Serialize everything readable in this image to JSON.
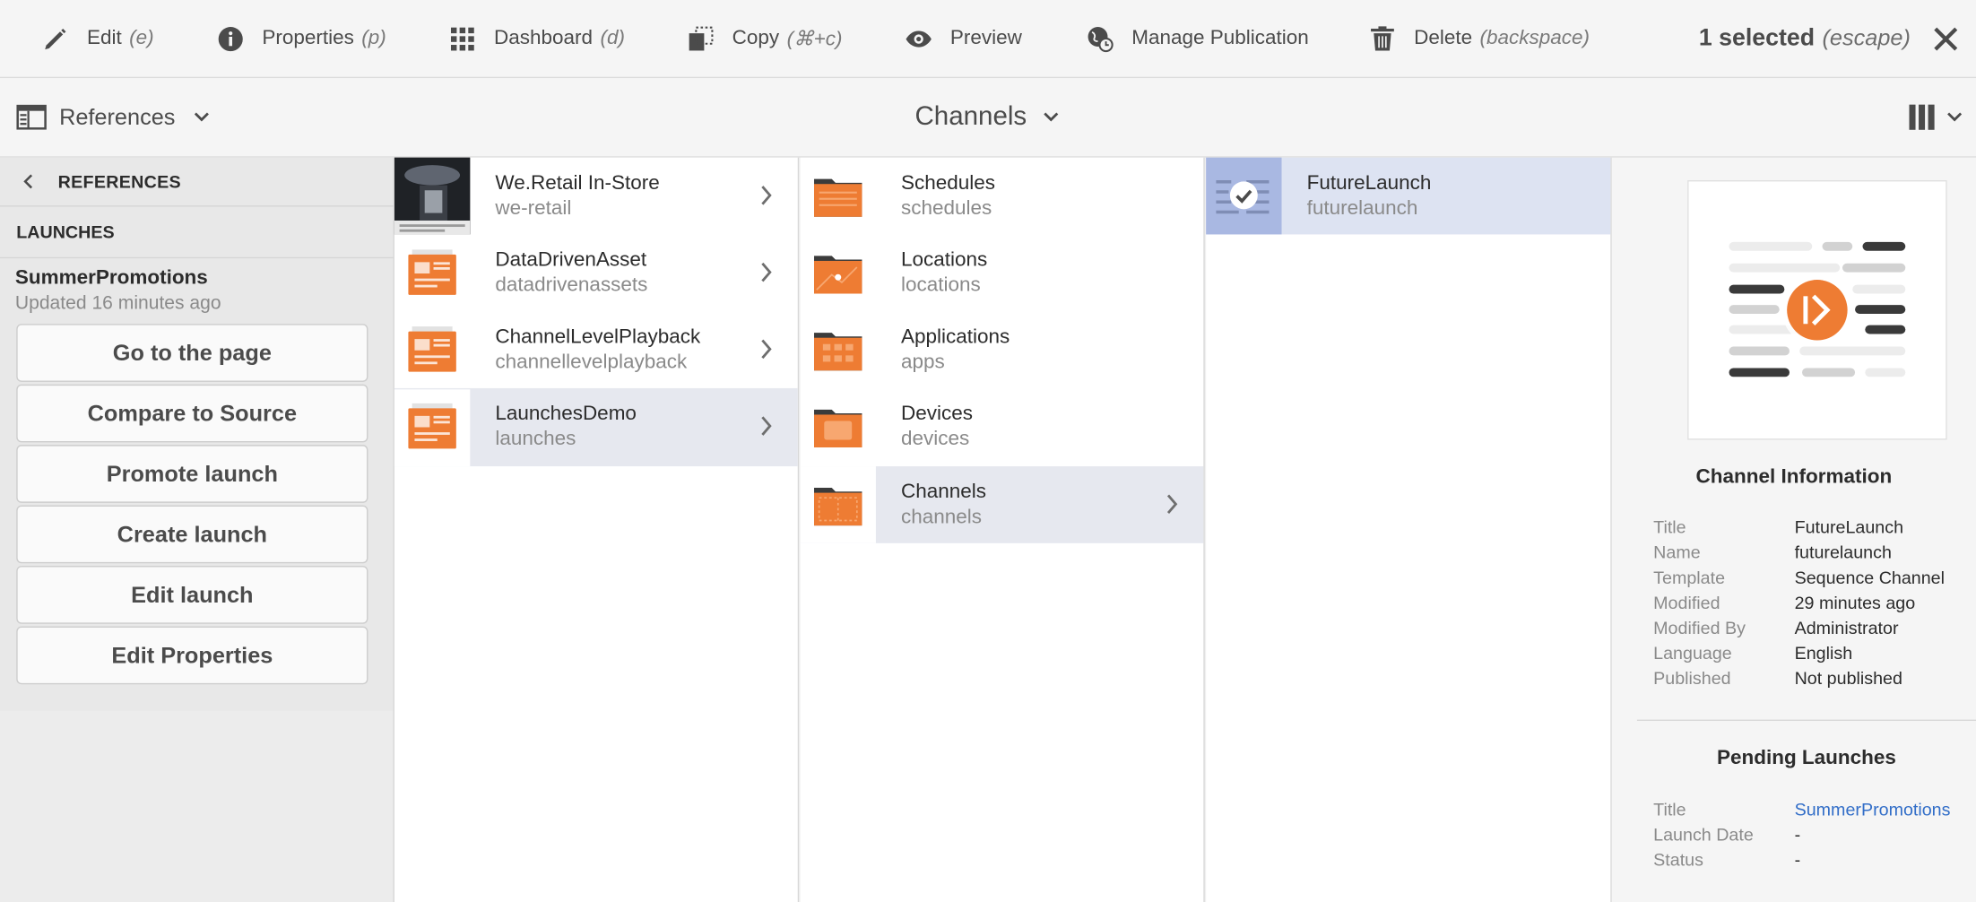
{
  "actionbar": {
    "edit": {
      "label": "Edit",
      "shortcut": "(e)"
    },
    "properties": {
      "label": "Properties",
      "shortcut": "(p)"
    },
    "dashboard": {
      "label": "Dashboard",
      "shortcut": "(d)"
    },
    "copy": {
      "label": "Copy",
      "shortcut": "(⌘+c)"
    },
    "preview": {
      "label": "Preview"
    },
    "publication": {
      "label": "Manage Publication"
    },
    "delete": {
      "label": "Delete",
      "shortcut": "(backspace)"
    },
    "selection": {
      "label": "1 selected",
      "shortcut": "(escape)"
    }
  },
  "titlebar": {
    "rail_label": "References",
    "page_title": "Channels"
  },
  "rail": {
    "header": "REFERENCES",
    "section": "LAUNCHES",
    "launch_name": "SummerPromotions",
    "launch_updated": "Updated 16 minutes ago",
    "buttons": [
      "Go to the page",
      "Compare to Source",
      "Promote launch",
      "Create launch",
      "Edit launch",
      "Edit Properties"
    ]
  },
  "columns": {
    "col1": [
      {
        "title": "We.Retail In-Store",
        "name": "we-retail"
      },
      {
        "title": "DataDrivenAsset",
        "name": "datadrivenassets"
      },
      {
        "title": "ChannelLevelPlayback",
        "name": "channellevelplayback"
      },
      {
        "title": "LaunchesDemo",
        "name": "launches"
      }
    ],
    "col2": [
      {
        "title": "Schedules",
        "name": "schedules"
      },
      {
        "title": "Locations",
        "name": "locations"
      },
      {
        "title": "Applications",
        "name": "apps"
      },
      {
        "title": "Devices",
        "name": "devices"
      },
      {
        "title": "Channels",
        "name": "channels"
      }
    ],
    "col3": [
      {
        "title": "FutureLaunch",
        "name": "futurelaunch"
      }
    ]
  },
  "details": {
    "channel_info_title": "Channel Information",
    "channel_info": [
      {
        "key": "Title",
        "value": "FutureLaunch"
      },
      {
        "key": "Name",
        "value": "futurelaunch"
      },
      {
        "key": "Template",
        "value": "Sequence Channel"
      },
      {
        "key": "Modified",
        "value": "29 minutes ago"
      },
      {
        "key": "Modified By",
        "value": "Administrator"
      },
      {
        "key": "Language",
        "value": "English"
      },
      {
        "key": "Published",
        "value": "Not published"
      }
    ],
    "pending_title": "Pending Launches",
    "pending": [
      {
        "key": "Title",
        "value": "SummerPromotions"
      },
      {
        "key": "Launch Date",
        "value": "-"
      },
      {
        "key": "Status",
        "value": "-"
      }
    ]
  },
  "colors": {
    "accent_orange": "#ee7c33",
    "selection_blue": "#dde3f2",
    "link": "#326ec8"
  }
}
